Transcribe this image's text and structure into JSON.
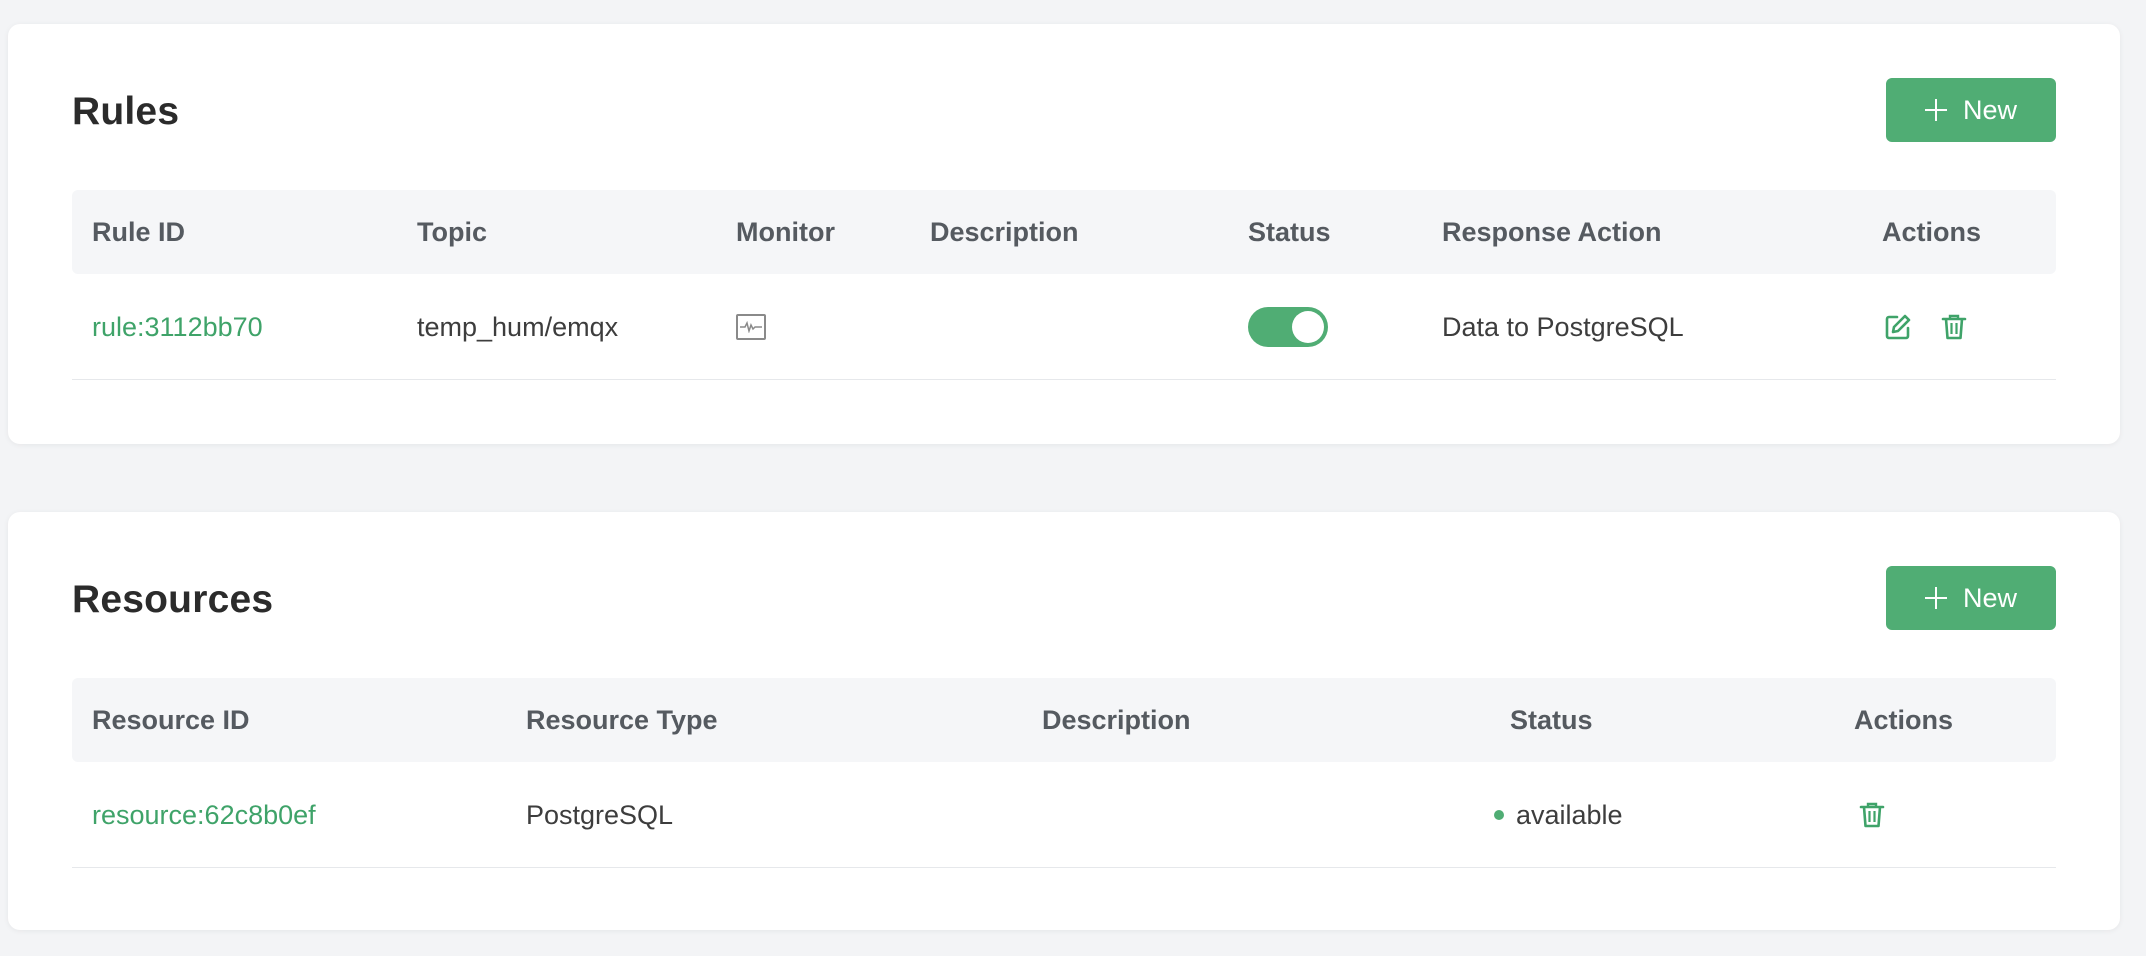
{
  "colors": {
    "accent": "#50ad74",
    "link": "#3fa369",
    "header_bg": "#f5f6f8",
    "page_bg": "#f3f4f6"
  },
  "rules": {
    "title": "Rules",
    "new_button": "New",
    "columns": [
      "Rule ID",
      "Topic",
      "Monitor",
      "Description",
      "Status",
      "Response Action",
      "Actions"
    ],
    "rows": [
      {
        "rule_id": "rule:3112bb70",
        "topic": "temp_hum/emqx",
        "monitor_icon": "monitor-chart-icon",
        "description": "",
        "status_enabled": true,
        "response_action": "Data to PostgreSQL",
        "actions": [
          "edit-icon",
          "trash-icon"
        ]
      }
    ]
  },
  "resources": {
    "title": "Resources",
    "new_button": "New",
    "columns": [
      "Resource ID",
      "Resource Type",
      "Description",
      "Status",
      "Actions"
    ],
    "rows": [
      {
        "resource_id": "resource:62c8b0ef",
        "resource_type": "PostgreSQL",
        "description": "",
        "status": "available",
        "actions": [
          "trash-icon"
        ]
      }
    ]
  }
}
